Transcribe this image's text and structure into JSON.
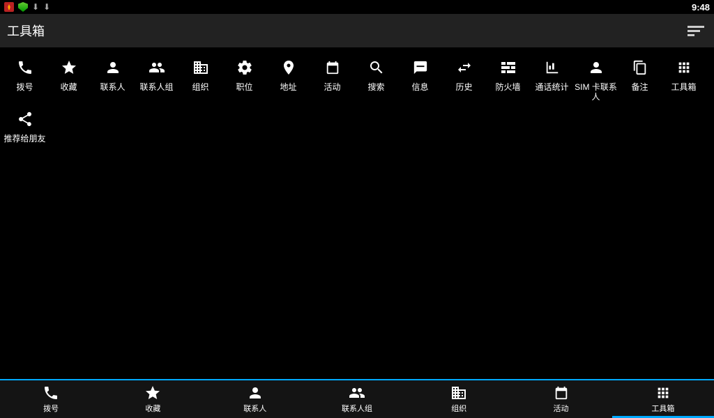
{
  "status": {
    "time": "9:48"
  },
  "title": "工具箱",
  "tiles": [
    {
      "name": "dial",
      "label": "拨号"
    },
    {
      "name": "favorites",
      "label": "收藏"
    },
    {
      "name": "contacts",
      "label": "联系人"
    },
    {
      "name": "groups",
      "label": "联系人组"
    },
    {
      "name": "org",
      "label": "组织"
    },
    {
      "name": "position",
      "label": "职位"
    },
    {
      "name": "address",
      "label": "地址"
    },
    {
      "name": "activity",
      "label": "活动"
    },
    {
      "name": "search",
      "label": "搜索"
    },
    {
      "name": "info",
      "label": "信息"
    },
    {
      "name": "history",
      "label": "历史"
    },
    {
      "name": "firewall",
      "label": "防火墙"
    },
    {
      "name": "callstats",
      "label": "通话统计"
    },
    {
      "name": "sim",
      "label": "SIM 卡联系人"
    },
    {
      "name": "notes",
      "label": "备注"
    },
    {
      "name": "toolbox",
      "label": "工具箱"
    },
    {
      "name": "share",
      "label": "推荐给朋友"
    }
  ],
  "nav": [
    {
      "name": "dial",
      "label": "拨号"
    },
    {
      "name": "favorites",
      "label": "收藏"
    },
    {
      "name": "contacts",
      "label": "联系人"
    },
    {
      "name": "groups",
      "label": "联系人组"
    },
    {
      "name": "org",
      "label": "组织"
    },
    {
      "name": "activity",
      "label": "活动"
    },
    {
      "name": "toolbox",
      "label": "工具箱"
    }
  ],
  "nav_active": "toolbox"
}
